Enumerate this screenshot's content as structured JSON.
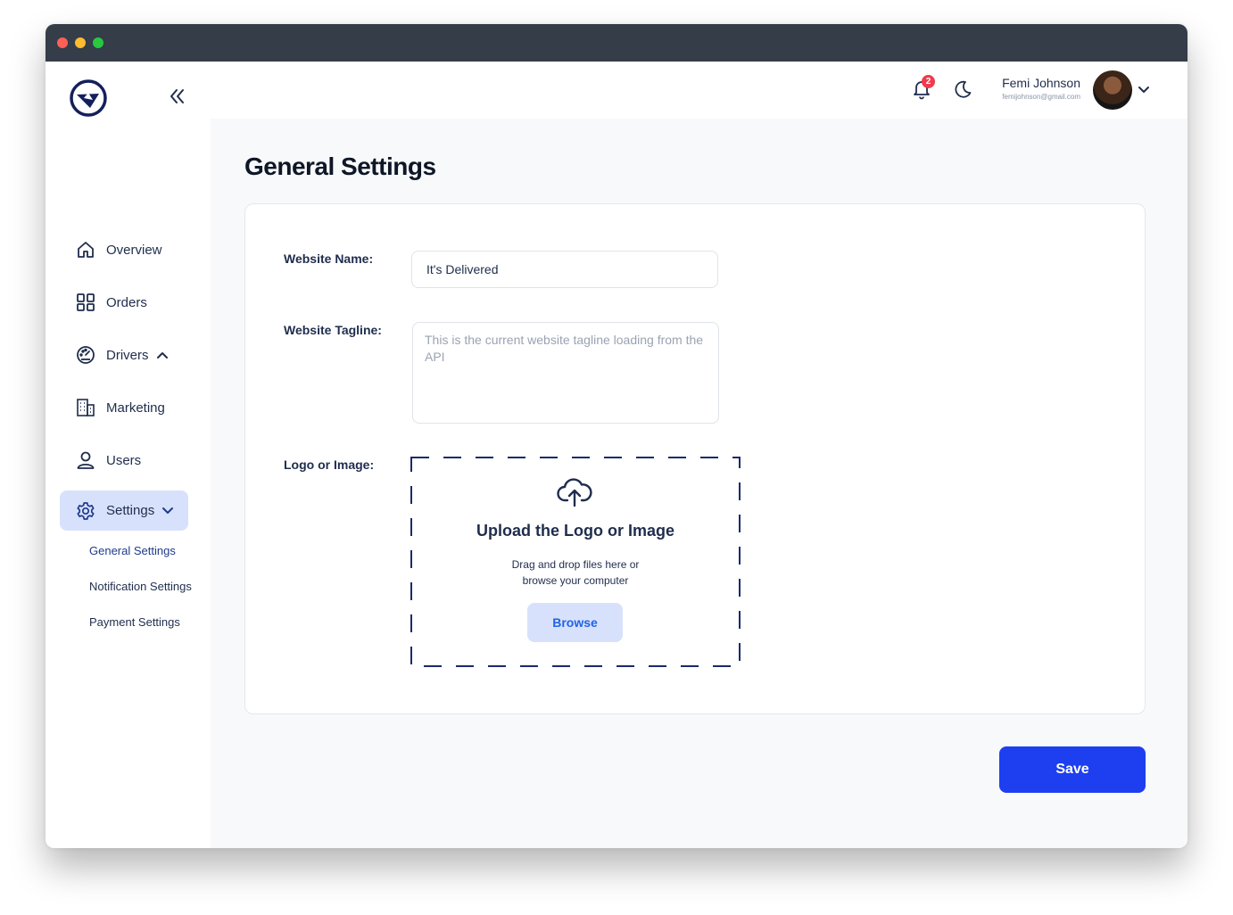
{
  "sidebar": {
    "items": [
      {
        "label": "Overview",
        "icon": "home-icon"
      },
      {
        "label": "Orders",
        "icon": "grid-icon"
      },
      {
        "label": "Drivers",
        "icon": "speedometer-icon"
      },
      {
        "label": "Marketing",
        "icon": "building-icon"
      },
      {
        "label": "Users",
        "icon": "user-icon"
      },
      {
        "label": "Settings",
        "icon": "gear-icon"
      }
    ],
    "settings_submenu": [
      "General Settings",
      "Notification Settings",
      "Payment Settings"
    ]
  },
  "header": {
    "notification_count": "2",
    "user_name": "Femi Johnson",
    "user_email": "femijohnson@gmail.com"
  },
  "main": {
    "title": "General Settings",
    "form": {
      "website_name_label": "Website Name:",
      "website_name_value": "It's Delivered",
      "tagline_label": "Website Tagline:",
      "tagline_placeholder": "This is the current website tagline loading from the API",
      "logo_label": "Logo or Image:"
    },
    "upload": {
      "title": "Upload the Logo or Image",
      "line1": "Drag and drop files here or",
      "line2": "browse your computer",
      "button": "Browse"
    },
    "save_label": "Save"
  },
  "colors": {
    "titlebar": "#343d48",
    "primary": "#1e3ff0",
    "active_nav": "#d8e1fc",
    "badge": "#ef3b4c",
    "dashed_border": "#1a2a6c"
  }
}
